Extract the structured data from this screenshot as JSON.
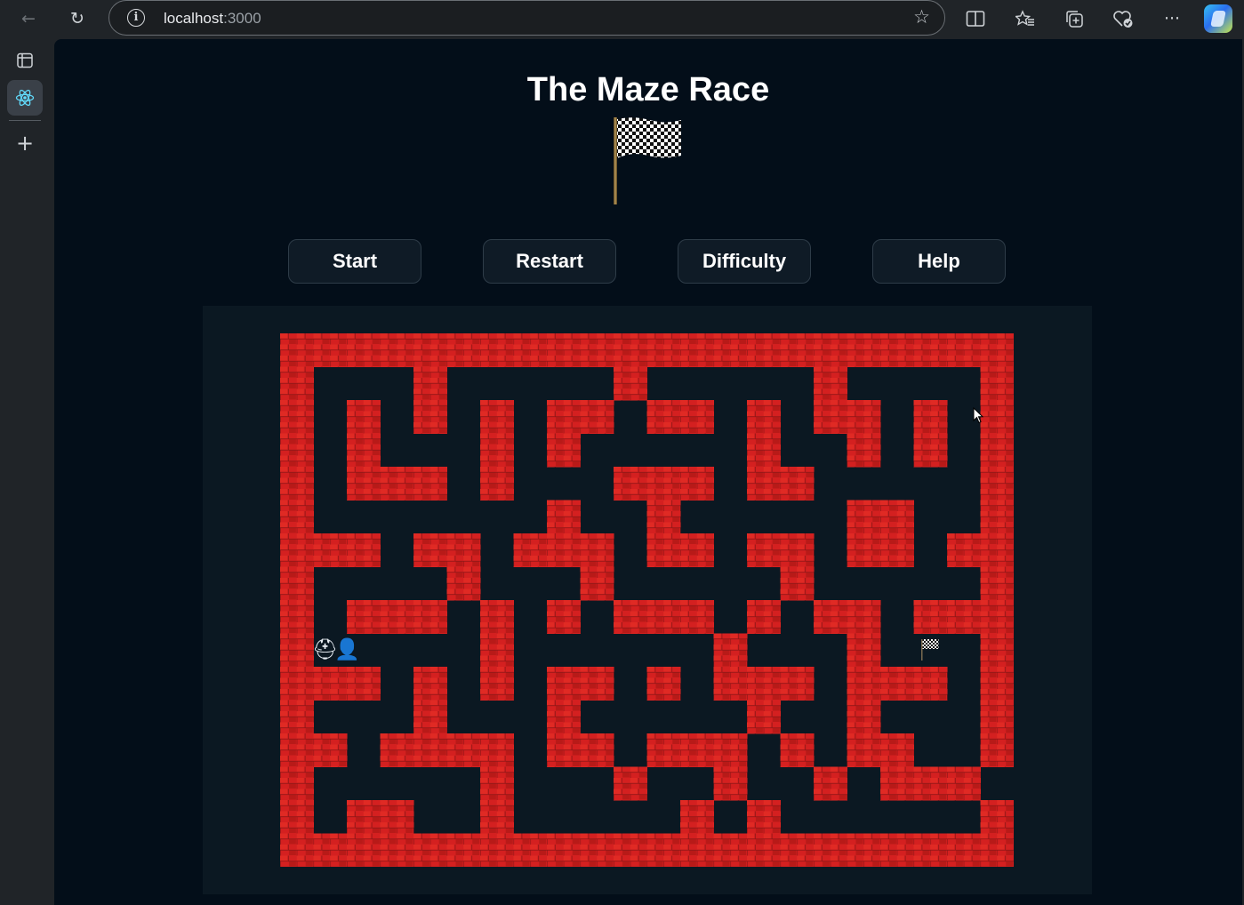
{
  "browser": {
    "url_host": "localhost",
    "url_port": ":3000",
    "icons": [
      "back-arrow-icon",
      "refresh-icon",
      "info-icon",
      "favorite-star-icon",
      "split-screen-icon",
      "favorites-icon",
      "collections-icon",
      "browser-essentials-icon",
      "more-options-icon",
      "copilot-icon",
      "tab-actions-icon",
      "react-app-tab-icon",
      "new-tab-plus-icon"
    ]
  },
  "page": {
    "title": "The Maze Race",
    "buttons": {
      "start": "Start",
      "restart": "Restart",
      "difficulty": "Difficulty",
      "help": "Help"
    }
  },
  "game": {
    "cols": 22,
    "rows": 16,
    "wall_color": "#d42020",
    "path_color": "#0b1822",
    "player_glyphs": "⛑👤",
    "player_icons": [
      "robot-racer-icon",
      "player-person-icon"
    ],
    "player_cell": [
      1,
      9
    ],
    "goal_cell": [
      19,
      9
    ],
    "goal_icon": "checkered-flag-icon",
    "walls": [
      "######################",
      "#...#.....#.....#....#",
      "#.#.#.#.##.##.#.##.#.#",
      "#.#...#.#.....#..#.#.#",
      "#.###.#...###.##.....#",
      "#.......#..#.....##..#",
      "###.##.###.##.##.##.##",
      "#....#...#.....#.....#",
      "#.###.#.#.###.#.##.###",
      "#.....#......#...#...#",
      "###.#.#.##.#.###.###.#",
      "#...#...#.....#..#...#",
      "##.####.##.###.#.##..#",
      "#.....#...#..#..#.###.#",
      "#.##..#.....#.#......#",
      "######################"
    ]
  }
}
